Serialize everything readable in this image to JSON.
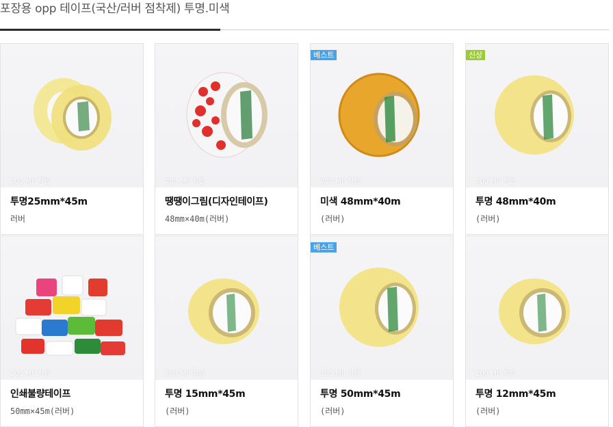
{
  "header": {
    "title": "포장용 opp 테이프(국산/러버 점착제) 투명.미색"
  },
  "colors": {
    "best_badge": "#4aa3e6",
    "new_badge": "#9acd32",
    "clear_tape": "#f2e28a",
    "beige_tape": "#e8a62c"
  },
  "products": [
    {
      "name": "투명25mm*45m",
      "sub": "러버",
      "points": "200 MP 적립",
      "badge": "",
      "image": "clear-tape-pair"
    },
    {
      "name": "땡땡이그림(디자인테이프)",
      "sub": "48mm×40m(러버)",
      "points": "200 MP 적립",
      "badge": "",
      "image": "polka-dot-tape"
    },
    {
      "name": "미색 48mm*40m",
      "sub": "(러버)",
      "points": "200 MP 적립",
      "badge": "베스트",
      "image": "beige-tape"
    },
    {
      "name": "투명 48mm*40m",
      "sub": "(러버)",
      "points": "200 MP 적립",
      "badge": "신상",
      "image": "clear-tape-wide"
    },
    {
      "name": "인쇄불량테이프",
      "sub": "50mm×45m(러버)",
      "points": "200 MP 적립",
      "badge": "",
      "image": "printed-tape-stack"
    },
    {
      "name": "투명 15mm*45m",
      "sub": "(러버)",
      "points": "200 MP 적립",
      "badge": "",
      "image": "clear-tape-narrow"
    },
    {
      "name": "투명 50mm*45m",
      "sub": "(러버)",
      "points": "200 MP 적립",
      "badge": "베스트",
      "image": "clear-tape-wide"
    },
    {
      "name": "투명 12mm*45m",
      "sub": "(러버)",
      "points": "200 MP 적립",
      "badge": "",
      "image": "clear-tape-narrow"
    }
  ]
}
